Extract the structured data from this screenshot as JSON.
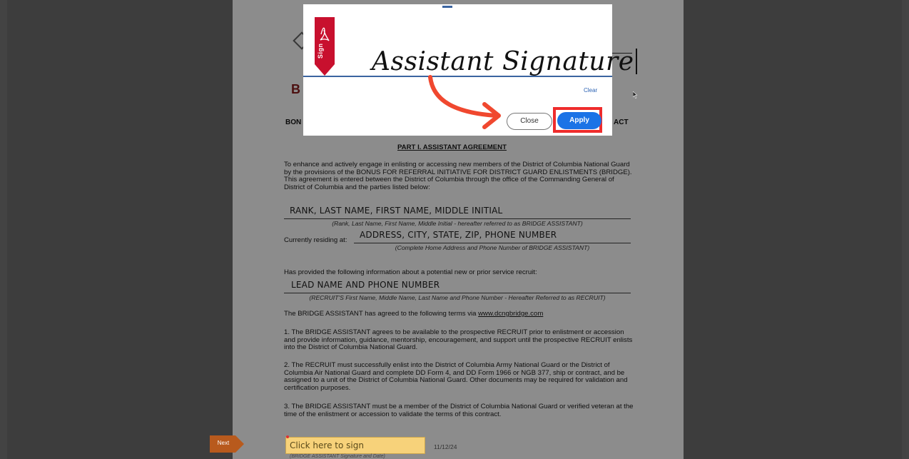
{
  "document": {
    "header_fragments": {
      "bon": "BON",
      "act": "ACT",
      "logo_letter": "B"
    },
    "section_title": "PART I.  ASSISTANT AGREEMENT",
    "intro": "To enhance and actively engage in enlisting or accessing new members of the District of Columbia National Guard by the provisions of the BONUS FOR REFERRAL INITIATIVE FOR DISTRICT GUARD ENLISTMENTS (BRIDGE). This agreement is entered between the District of Columbia through the office of the Commanding General of District of Columbia and the parties listed below:",
    "fields": {
      "name_value": "RANK, LAST NAME, FIRST NAME, MIDDLE INITIAL",
      "name_caption": "(Rank, Last Name, First Name, Middle Initial - hereafter referred to as BRIDGE ASSISTANT)",
      "residing_label": "Currently residing at:",
      "address_value": "ADDRESS, CITY, STATE, ZIP, PHONE NUMBER",
      "address_caption": "(Complete Home Address and Phone Number of BRIDGE ASSISTANT)",
      "recruit_intro": "Has provided the following information about a potential new or prior service recruit:",
      "lead_value": "LEAD NAME AND PHONE NUMBER",
      "lead_caption": "(RECRUIT'S First Name, Middle Name, Last Name and Phone Number - Hereafter Referred to as RECRUIT)"
    },
    "terms_intro_prefix": "The BRIDGE ASSISTANT has agreed to the following terms via ",
    "terms_link": "www.dcngbridge.com",
    "term1": "1. The BRIDGE ASSISTANT agrees to be available to the prospective RECRUIT prior to enlistment or accession and provide information, guidance, mentorship, encouragement, and support until the prospective RECRUIT enlists into the District of Columbia National Guard.",
    "term2": "2. The RECRUIT must successfully enlist into the District of Columbia Army National Guard or the District of Columbia Air National Guard and complete DD Form 4, and DD Form 1966 or NGB 377, ship or contract, and be assigned to a unit of the District of Columbia National Guard. Other documents may be required for validation and certification purposes.",
    "term3": "3. The BRIDGE ASSISTANT must be a member of the District of Columbia National Guard or verified veteran at the time of the enlistment or accession to validate the terms of this contract.",
    "sign_field_placeholder": "Click here to sign",
    "sign_date": "11/12/24",
    "sign_caption": "(BRIDGE ASSISTANT Signature and Date)"
  },
  "navigation": {
    "next_label": "Next"
  },
  "sign_dialog": {
    "badge_text": "Sign",
    "signature_text": "Assistant Signature",
    "clear_label": "Clear",
    "close_label": "Close",
    "apply_label": "Apply"
  },
  "colors": {
    "apply_blue": "#1b73e6",
    "highlight_red": "#ef2c2c",
    "annotation_arrow": "#f0482f",
    "badge_red": "#c8102e",
    "sign_field_yellow": "#f7d27a"
  },
  "icons": {
    "badge": "adobe-acrobat-icon",
    "arrow": "curved-arrow-annotation",
    "cursor": "mouse-pointer-icon"
  }
}
